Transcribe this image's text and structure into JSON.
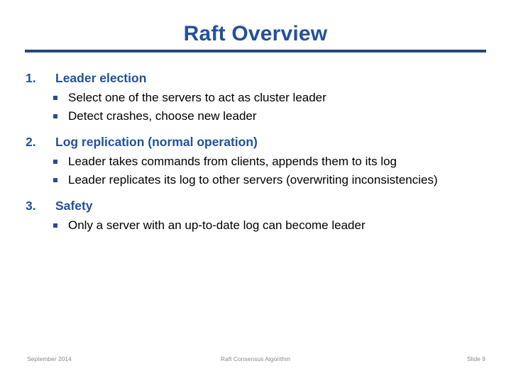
{
  "slide": {
    "title": "Raft Overview",
    "accent_color": "#23509B",
    "rule_color": "#24477F",
    "bullet_color": "#2B4C8C",
    "body_color": "#000000",
    "background_color": "#FFFFFF",
    "items": [
      {
        "number": "1.",
        "title": "Leader election",
        "bullets": [
          "Select one of the servers to act as cluster leader",
          "Detect crashes, choose new leader"
        ]
      },
      {
        "number": "2.",
        "title": "Log replication (normal operation)",
        "bullets": [
          "Leader takes commands from clients, appends them to its log",
          "Leader replicates its log to other servers (overwriting inconsistencies)"
        ]
      },
      {
        "number": "3.",
        "title": "Safety",
        "bullets": [
          "Only a server with an up-to-date log can become leader"
        ]
      }
    ]
  },
  "footer": {
    "left": "September 2014",
    "center": "Raft Consensus Algorithm",
    "right": "Slide 9",
    "color": "#8A8A8A"
  }
}
